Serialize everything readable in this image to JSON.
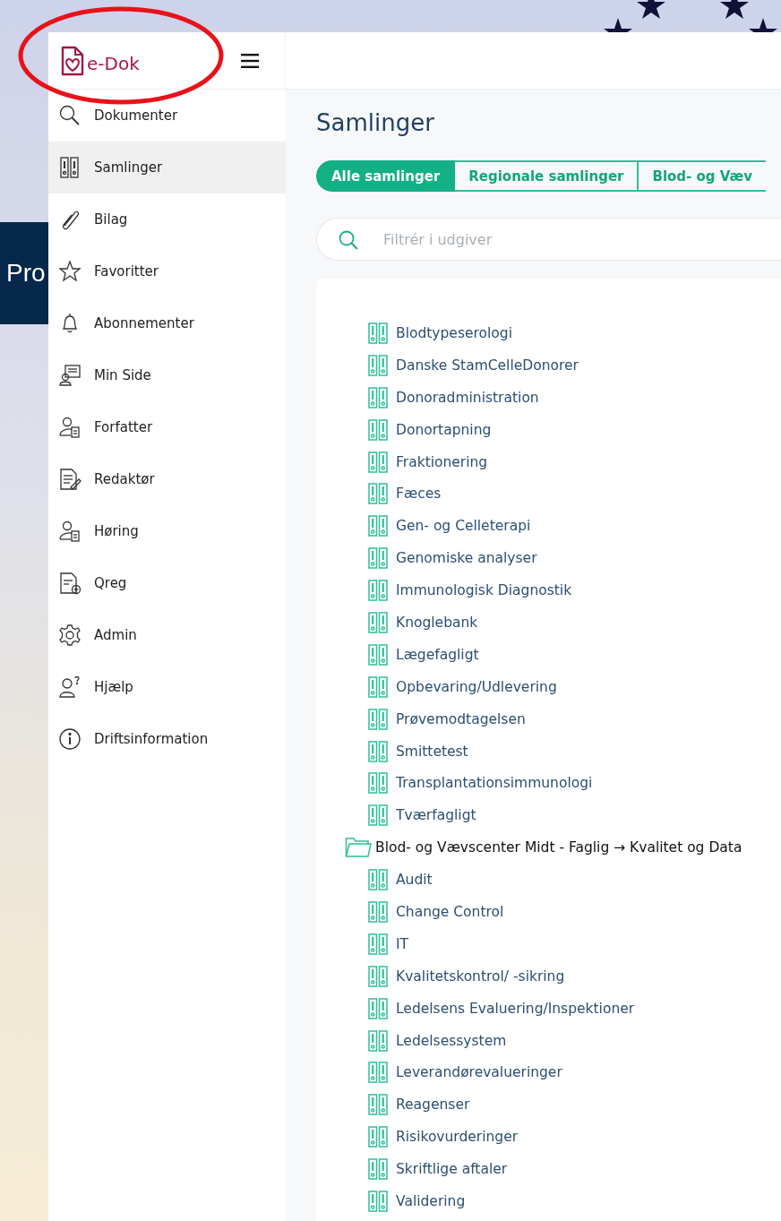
{
  "background": {
    "banner_text": "Pro"
  },
  "logo": {
    "text": "e-Dok"
  },
  "sidebar": {
    "items": [
      {
        "label": "Dokumenter",
        "selected": false
      },
      {
        "label": "Samlinger",
        "selected": true
      },
      {
        "label": "Bilag",
        "selected": false
      },
      {
        "label": "Favoritter",
        "selected": false
      },
      {
        "label": "Abonnementer",
        "selected": false
      },
      {
        "label": "Min Side",
        "selected": false
      },
      {
        "label": "Forfatter",
        "selected": false
      },
      {
        "label": "Redaktør",
        "selected": false
      },
      {
        "label": "Høring",
        "selected": false
      },
      {
        "label": "Qreg",
        "selected": false
      },
      {
        "label": "Admin",
        "selected": false
      },
      {
        "label": "Hjælp",
        "selected": false
      },
      {
        "label": "Driftsinformation",
        "selected": false
      }
    ]
  },
  "page": {
    "title": "Samlinger"
  },
  "tabs": [
    {
      "label": "Alle samlinger",
      "selected": true
    },
    {
      "label": "Regionale samlinger",
      "selected": false
    },
    {
      "label": "Blod- og Væv",
      "selected": false
    }
  ],
  "search": {
    "placeholder": "Filtrér i udgiver"
  },
  "tree": [
    {
      "kind": "collection",
      "label": "Blodtypeserologi"
    },
    {
      "kind": "collection",
      "label": "Danske StamCelleDonorer"
    },
    {
      "kind": "collection",
      "label": "Donoradministration"
    },
    {
      "kind": "collection",
      "label": "Donortapning"
    },
    {
      "kind": "collection",
      "label": "Fraktionering"
    },
    {
      "kind": "collection",
      "label": "Fæces"
    },
    {
      "kind": "collection",
      "label": "Gen- og Celleterapi"
    },
    {
      "kind": "collection",
      "label": "Genomiske analyser"
    },
    {
      "kind": "collection",
      "label": "Immunologisk Diagnostik"
    },
    {
      "kind": "collection",
      "label": "Knoglebank"
    },
    {
      "kind": "collection",
      "label": "Lægefagligt"
    },
    {
      "kind": "collection",
      "label": "Opbevaring/Udlevering"
    },
    {
      "kind": "collection",
      "label": "Prøvemodtagelsen"
    },
    {
      "kind": "collection",
      "label": "Smittetest"
    },
    {
      "kind": "collection",
      "label": "Transplantationsimmunologi"
    },
    {
      "kind": "collection",
      "label": "Tværfagligt"
    },
    {
      "kind": "folder",
      "label": "Blod- og Vævscenter Midt - Faglig → Kvalitet og Data",
      "children": [
        {
          "kind": "collection",
          "label": "Audit"
        },
        {
          "kind": "collection",
          "label": "Change Control"
        },
        {
          "kind": "collection",
          "label": "IT"
        },
        {
          "kind": "collection",
          "label": "Kvalitetskontrol/ -sikring"
        },
        {
          "kind": "collection",
          "label": "Ledelsens Evaluering/Inspektioner"
        },
        {
          "kind": "collection",
          "label": "Ledelsessystem"
        },
        {
          "kind": "collection",
          "label": "Leverandørevalueringer"
        },
        {
          "kind": "collection",
          "label": "Reagenser"
        },
        {
          "kind": "collection",
          "label": "Risikovurderinger"
        },
        {
          "kind": "collection",
          "label": "Skriftlige aftaler"
        },
        {
          "kind": "collection",
          "label": "Validering"
        }
      ]
    }
  ]
}
